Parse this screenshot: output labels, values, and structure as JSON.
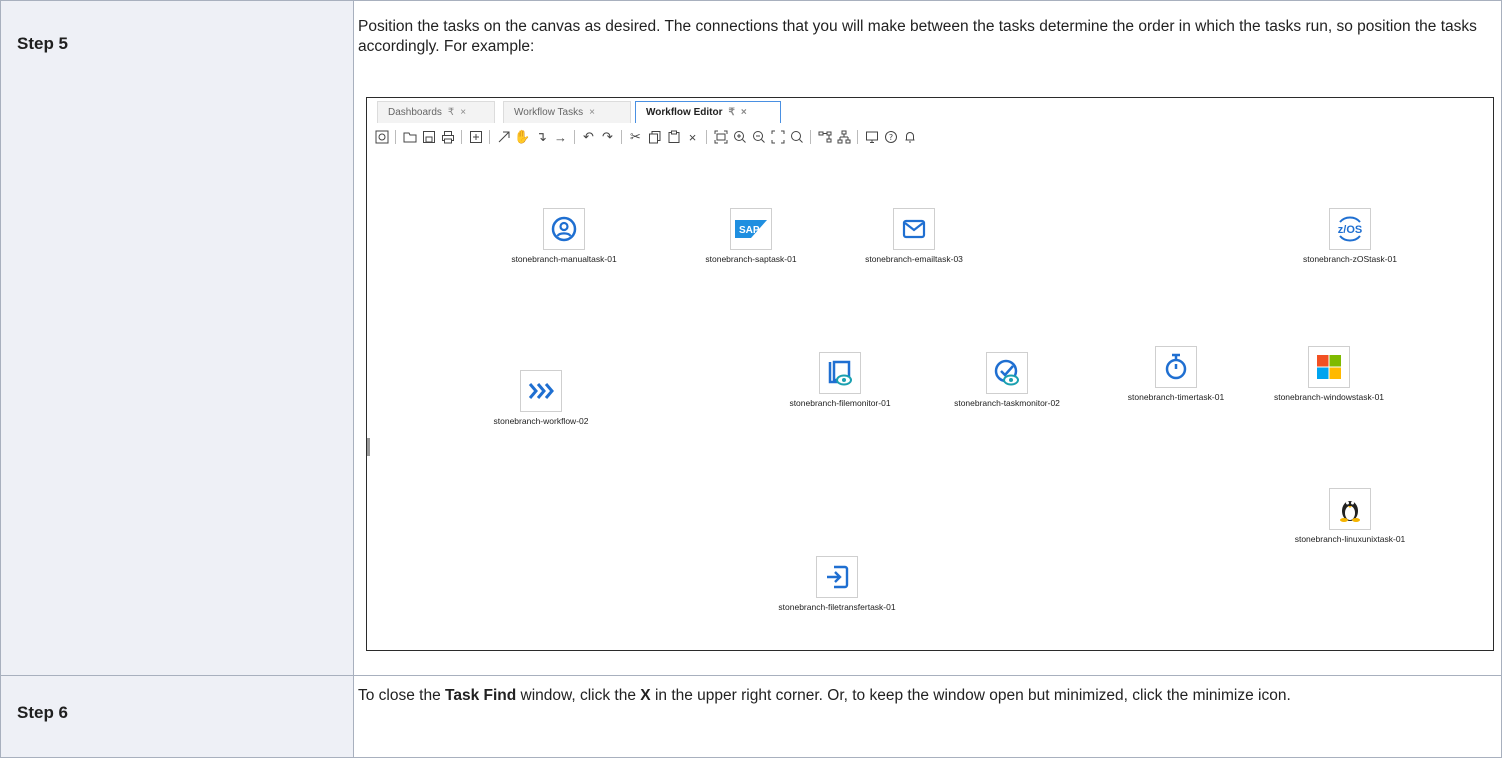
{
  "steps": [
    {
      "label": "Step 5",
      "text": "Position the tasks on the canvas as desired. The connections that you will make between the tasks determine the order in which the tasks run, so position the tasks accordingly. For example:"
    },
    {
      "label": "Step 6",
      "text_parts": [
        "To close the ",
        "Task Find",
        " window, click the ",
        "X",
        " in the upper right corner. Or, to keep the window open but minimized, click the minimize icon."
      ]
    }
  ],
  "editor": {
    "tabs": [
      {
        "label": "Dashboards",
        "pin": "₹",
        "close": "×"
      },
      {
        "label": "Workflow Tasks",
        "close": "×"
      },
      {
        "label": "Workflow Editor",
        "pin": "₹",
        "close": "×"
      }
    ],
    "tasks": [
      {
        "name": "stonebranch-manualtask-01",
        "icon": "user-circle-icon"
      },
      {
        "name": "stonebranch-saptask-01",
        "icon": "sap-logo-icon"
      },
      {
        "name": "stonebranch-emailtask-03",
        "icon": "email-icon"
      },
      {
        "name": "stonebranch-zOStask-01",
        "icon": "zos-icon",
        "icon_text": "z/OS"
      },
      {
        "name": "stonebranch-workflow-02",
        "icon": "workflow-icon"
      },
      {
        "name": "stonebranch-filemonitor-01",
        "icon": "file-monitor-icon"
      },
      {
        "name": "stonebranch-taskmonitor-02",
        "icon": "task-monitor-icon"
      },
      {
        "name": "stonebranch-timertask-01",
        "icon": "timer-icon"
      },
      {
        "name": "stonebranch-windowstask-01",
        "icon": "windows-logo-icon"
      },
      {
        "name": "stonebranch-linuxunixtask-01",
        "icon": "linux-tux-icon"
      },
      {
        "name": "stonebranch-filetransfertask-01",
        "icon": "file-transfer-icon"
      }
    ],
    "colors": {
      "accent": "#1f6fd1",
      "active_tab_border": "#4a90e2"
    }
  }
}
